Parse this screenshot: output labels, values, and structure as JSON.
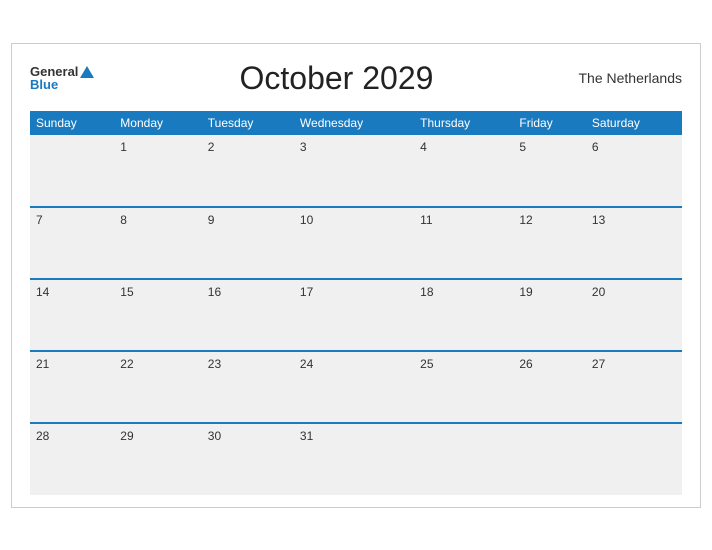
{
  "header": {
    "logo_general": "General",
    "logo_blue": "Blue",
    "title": "October 2029",
    "country": "The Netherlands"
  },
  "days": [
    "Sunday",
    "Monday",
    "Tuesday",
    "Wednesday",
    "Thursday",
    "Friday",
    "Saturday"
  ],
  "weeks": [
    [
      "",
      "1",
      "2",
      "3",
      "4",
      "5",
      "6"
    ],
    [
      "7",
      "8",
      "9",
      "10",
      "11",
      "12",
      "13"
    ],
    [
      "14",
      "15",
      "16",
      "17",
      "18",
      "19",
      "20"
    ],
    [
      "21",
      "22",
      "23",
      "24",
      "25",
      "26",
      "27"
    ],
    [
      "28",
      "29",
      "30",
      "31",
      "",
      "",
      ""
    ]
  ]
}
